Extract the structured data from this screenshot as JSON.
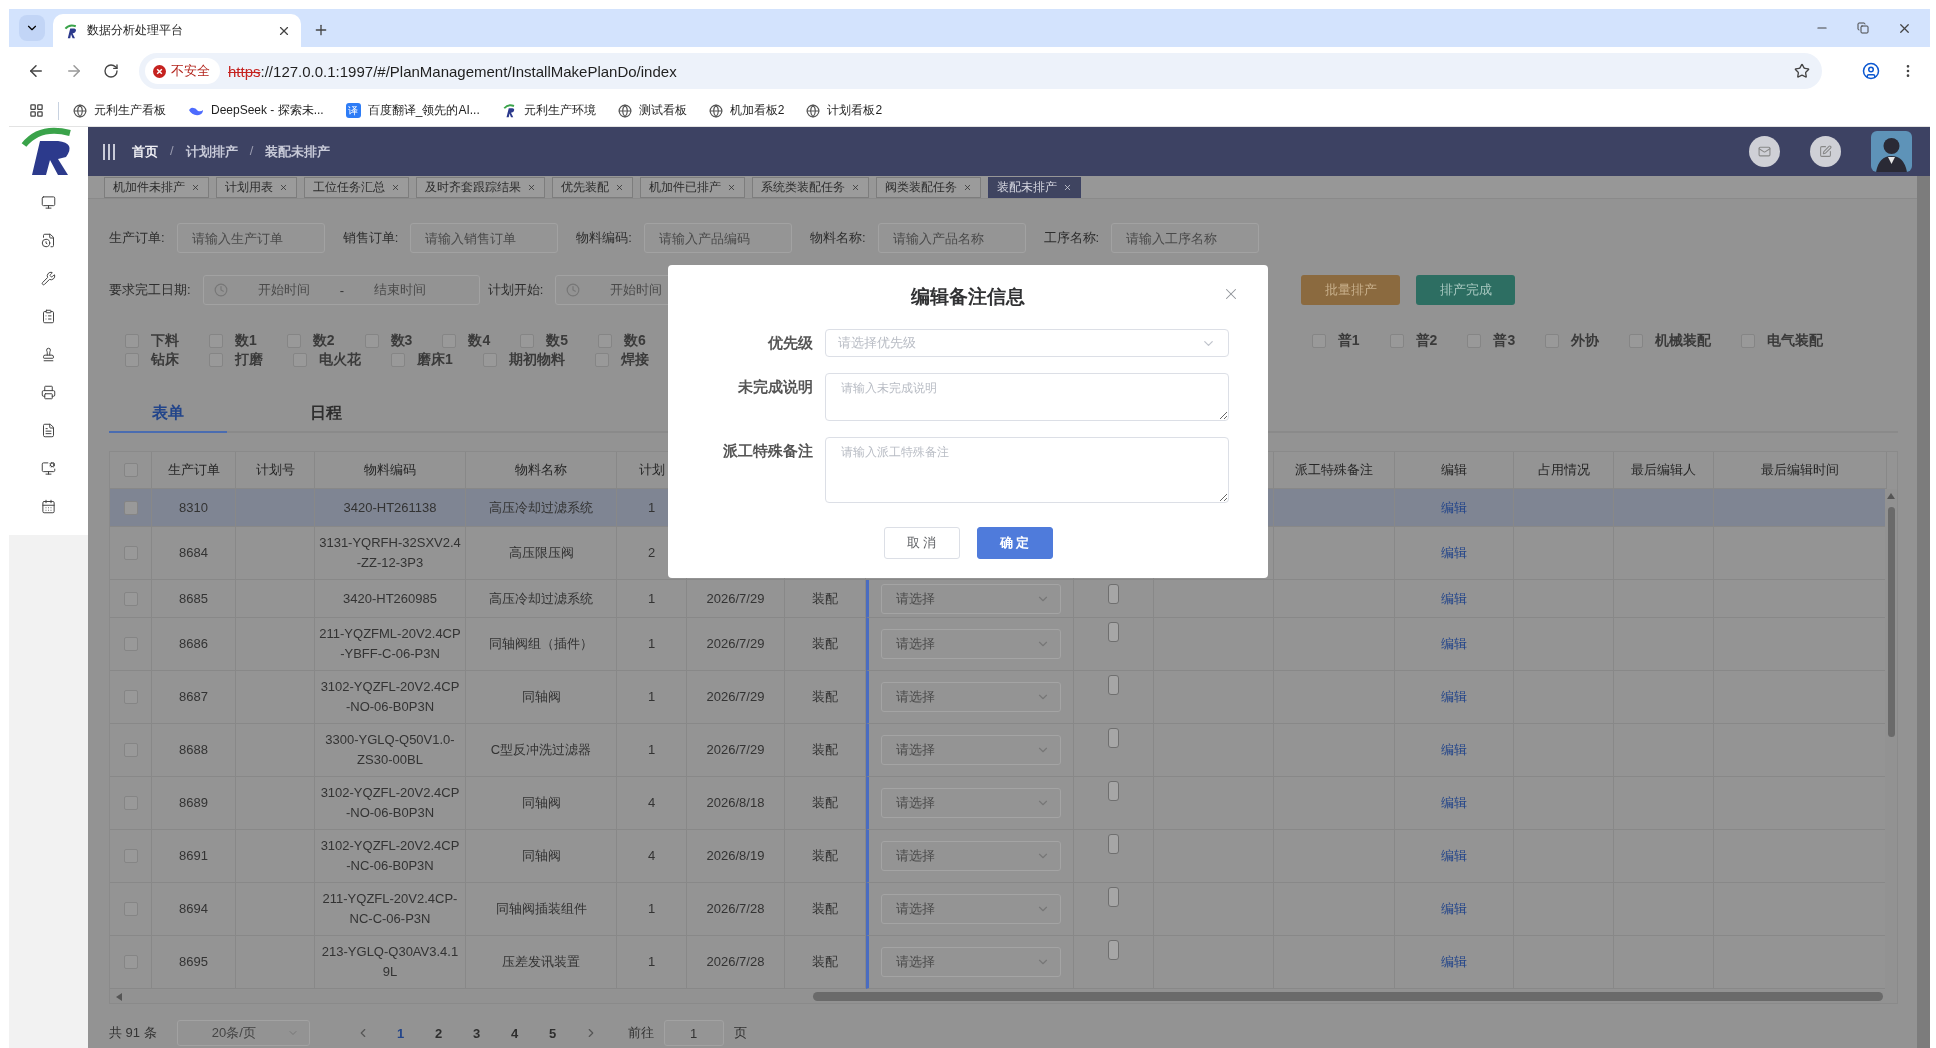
{
  "browser": {
    "tab_title": "数据分析处理平台",
    "security_label": "不安全",
    "url_scheme": "https",
    "url_rest": "://127.0.0.1:1997/#/PlanManagement/InstallMakePlanDo/index",
    "bookmarks": [
      {
        "label": "元利生产看板",
        "kind": "globe"
      },
      {
        "label": "DeepSeek - 探索未...",
        "kind": "whale"
      },
      {
        "label": "百度翻译_领先的AI...",
        "kind": "badge",
        "badge": "译"
      },
      {
        "label": "元利生产环境",
        "kind": "logo"
      },
      {
        "label": "测试看板",
        "kind": "globe"
      },
      {
        "label": "机加看板2",
        "kind": "globe"
      },
      {
        "label": "计划看板2",
        "kind": "globe"
      }
    ]
  },
  "header": {
    "breadcrumb": [
      "首页",
      "计划排产",
      "装配未排产"
    ],
    "separator": "/"
  },
  "tags": [
    {
      "label": "机加件未排产",
      "selected": false
    },
    {
      "label": "计划用表",
      "selected": false
    },
    {
      "label": "工位任务汇总",
      "selected": false
    },
    {
      "label": "及时齐套跟踪结果",
      "selected": false
    },
    {
      "label": "优先装配",
      "selected": false
    },
    {
      "label": "机加件已排产",
      "selected": false
    },
    {
      "label": "系统类装配任务",
      "selected": false
    },
    {
      "label": "阀类装配任务",
      "selected": false
    },
    {
      "label": "装配未排产",
      "selected": true
    }
  ],
  "filters": [
    {
      "label": "生产订单:",
      "placeholder": "请输入生产订单"
    },
    {
      "label": "销售订单:",
      "placeholder": "请输入销售订单"
    },
    {
      "label": "物料编码:",
      "placeholder": "请输入产品编码"
    },
    {
      "label": "物料名称:",
      "placeholder": "请输入产品名称"
    },
    {
      "label": "工序名称:",
      "placeholder": "请输入工序名称"
    }
  ],
  "date_filters": [
    {
      "label": "要求完工日期:",
      "start": "开始时间",
      "separator": "-",
      "end": "结束时间"
    },
    {
      "label": "计划开始:",
      "start": "开始时间"
    }
  ],
  "actions": [
    {
      "label": "批量排产",
      "kind": "warning"
    },
    {
      "label": "排产完成",
      "kind": "success"
    }
  ],
  "category_rows": [
    {
      "left": [
        {
          "label": "下料",
          "checked": false
        },
        {
          "label": "数1",
          "checked": false
        },
        {
          "label": "数2",
          "checked": false
        },
        {
          "label": "数3",
          "checked": false
        },
        {
          "label": "数4",
          "checked": false
        },
        {
          "label": "数5",
          "checked": false
        },
        {
          "label": "数6",
          "checked": false
        }
      ],
      "right": [
        {
          "label": "普1",
          "checked": false
        },
        {
          "label": "普2",
          "checked": false
        },
        {
          "label": "普3",
          "checked": false
        },
        {
          "label": "外协",
          "checked": false
        },
        {
          "label": "机械装配",
          "checked": false
        },
        {
          "label": "电气装配",
          "checked": false
        }
      ]
    },
    {
      "left": [
        {
          "label": "钻床",
          "checked": false
        },
        {
          "label": "打磨",
          "checked": false
        },
        {
          "label": "电火花",
          "checked": false
        },
        {
          "label": "磨床1",
          "checked": false
        },
        {
          "label": "期初物料",
          "checked": false
        },
        {
          "label": "焊接",
          "checked": false
        }
      ]
    }
  ],
  "view_tabs": [
    {
      "label": "表单",
      "selected": true
    },
    {
      "label": "日程",
      "selected": false
    }
  ],
  "table": {
    "all_checked": false,
    "columns_left": [
      "生产订单",
      "计划号",
      "物料编码",
      "物料名称",
      "计划"
    ],
    "columns_right": [
      "派工特殊备注",
      "编辑",
      "占用情况",
      "最后编辑人",
      "最后编辑时间"
    ],
    "rows": [
      {
        "order": "8310",
        "material_code": "3420-HT261138",
        "material_name": "高压冷却过滤系统",
        "qty": "1",
        "edit": "编辑",
        "selected": true,
        "checked": false
      },
      {
        "order": "8684",
        "material_code": "3131-YQRFH-32SXV2.4\n-ZZ-12-3P3",
        "material_name": "高压限压阀",
        "qty": "2",
        "edit": "编辑",
        "selected": false,
        "checked": false
      },
      {
        "order": "8685",
        "material_code": "3420-HT260985",
        "material_name": "高压冷却过滤系统",
        "qty": "1",
        "date": "2026/7/29",
        "process": "装配",
        "select_placeholder": "请选择",
        "edit": "编辑",
        "selected": false,
        "checked": false
      },
      {
        "order": "8686",
        "material_code": "211-YQZFML-20V2.4CP\n-YBFF-C-06-P3N",
        "material_name": "同轴阀组（插件）",
        "qty": "1",
        "date": "2026/7/29",
        "process": "装配",
        "select_placeholder": "请选择",
        "edit": "编辑",
        "selected": false,
        "checked": false
      },
      {
        "order": "8687",
        "material_code": "3102-YQZFL-20V2.4CP\n-NO-06-B0P3N",
        "material_name": "同轴阀",
        "qty": "1",
        "date": "2026/7/29",
        "process": "装配",
        "select_placeholder": "请选择",
        "edit": "编辑",
        "selected": false,
        "checked": false
      },
      {
        "order": "8688",
        "material_code": "3300-YGLQ-Q50V1.0-\nZS30-00BL",
        "material_name": "C型反冲洗过滤器",
        "qty": "1",
        "date": "2026/7/29",
        "process": "装配",
        "select_placeholder": "请选择",
        "edit": "编辑",
        "selected": false,
        "checked": false
      },
      {
        "order": "8689",
        "material_code": "3102-YQZFL-20V2.4CP\n-NO-06-B0P3N",
        "material_name": "同轴阀",
        "qty": "4",
        "date": "2026/8/18",
        "process": "装配",
        "select_placeholder": "请选择",
        "edit": "编辑",
        "selected": false,
        "checked": false
      },
      {
        "order": "8691",
        "material_code": "3102-YQZFL-20V2.4CP\n-NC-06-B0P3N",
        "material_name": "同轴阀",
        "qty": "4",
        "date": "2026/8/19",
        "process": "装配",
        "select_placeholder": "请选择",
        "edit": "编辑",
        "selected": false,
        "checked": false
      },
      {
        "order": "8694",
        "material_code": "211-YQZFL-20V2.4CP-\nNC-C-06-P3N",
        "material_name": "同轴阀插装组件",
        "qty": "1",
        "date": "2026/7/28",
        "process": "装配",
        "select_placeholder": "请选择",
        "edit": "编辑",
        "selected": false,
        "checked": false
      },
      {
        "order": "8695",
        "material_code": "213-YGLQ-Q30AV3.4.1\n9L",
        "material_name": "压差发讯装置",
        "qty": "1",
        "date": "2026/7/28",
        "process": "装配",
        "select_placeholder": "请选择",
        "edit": "编辑",
        "selected": false,
        "checked": false
      }
    ]
  },
  "pagination": {
    "total": "共 91 条",
    "page_size": "20条/页",
    "pages": [
      {
        "label": "1",
        "selected": true
      },
      {
        "label": "2",
        "selected": false
      },
      {
        "label": "3",
        "selected": false
      },
      {
        "label": "4",
        "selected": false
      },
      {
        "label": "5",
        "selected": false
      }
    ],
    "goto_label": "前往",
    "goto_value": "1",
    "page_unit": "页"
  },
  "dialog": {
    "title": "编辑备注信息",
    "fields": [
      {
        "label": "优先级",
        "kind": "select",
        "placeholder": "请选择优先级"
      },
      {
        "label": "未完成说明",
        "kind": "textarea",
        "placeholder": "请输入未完成说明"
      },
      {
        "label": "派工特殊备注",
        "kind": "textarea",
        "placeholder": "请输入派工特殊备注"
      }
    ],
    "buttons": [
      {
        "label": "取 消",
        "kind": "default"
      },
      {
        "label": "确 定",
        "kind": "primary"
      }
    ]
  }
}
